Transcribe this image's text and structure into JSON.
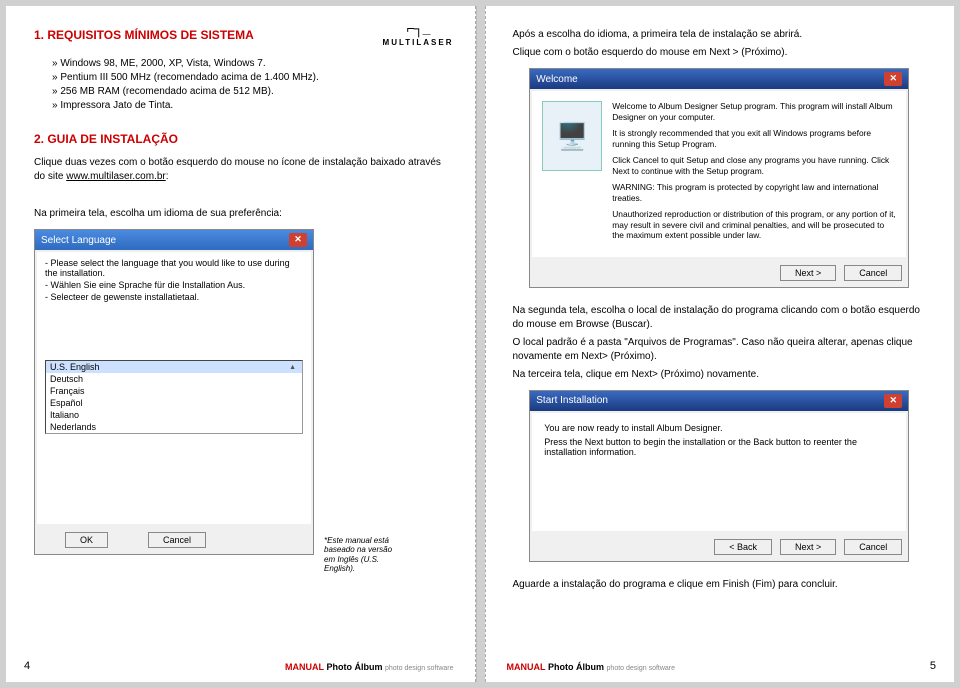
{
  "brand": {
    "glyph": "⌐┐_",
    "name": "MULTILASER"
  },
  "left": {
    "section1_title": "1. REQUISITOS MÍNIMOS DE SISTEMA",
    "requirements": [
      "Windows 98, ME, 2000, XP, Vista, Windows 7.",
      "Pentium III 500 MHz (recomendado acima de 1.400 MHz).",
      "256 MB RAM (recomendado acima de 512 MB).",
      "Impressora Jato de Tinta."
    ],
    "section2_title": "2. GUIA DE INSTALAÇÃO",
    "guide_p1_a": "Clique duas vezes com o botão esquerdo do mouse no ícone de instalação baixado através do site ",
    "guide_p1_link": "www.multilaser.com.br",
    "guide_p1_b": ":",
    "guide_p2": "Na primeira tela, escolha um idioma de sua preferência:",
    "lang_dialog": {
      "title": "Select Language",
      "lines": [
        "- Please select the language that you would like to use during the installation.",
        "- Wählen Sie eine Sprache für die Installation Aus.",
        "- Selecteer de gewenste installatietaal."
      ],
      "options": [
        "U.S. English",
        "Deutsch",
        "Français",
        "Español",
        "Italiano",
        "Nederlands"
      ],
      "ok": "OK",
      "cancel": "Cancel"
    },
    "footnote": "*Este manual está baseado na versão em Inglês (U.S. English).",
    "page_number": "4"
  },
  "right": {
    "intro_p1": "Após a escolha do idioma, a primeira tela de instalação se abrirá.",
    "intro_p2": "Clique com o botão esquerdo do mouse em Next > (Próximo).",
    "welcome_dialog": {
      "title": "Welcome",
      "p1": "Welcome to Album Designer Setup program. This program will install Album Designer on your computer.",
      "p2": "It is strongly recommended that you exit all Windows programs before running this Setup Program.",
      "p3": "Click Cancel to quit Setup and close any programs you have running. Click Next to continue with the Setup program.",
      "p4": "WARNING: This program is protected by copyright law and international treaties.",
      "p5": "Unauthorized reproduction or distribution of this program, or any portion of it, may result in severe civil and criminal penalties, and will be prosecuted to the maximum extent possible under law.",
      "next": "Next >",
      "cancel": "Cancel"
    },
    "mid_p1": "Na segunda tela, escolha o local de instalação do programa clicando com o botão esquerdo do mouse em Browse (Buscar).",
    "mid_p2": "O local padrão é a pasta \"Arquivos de Programas\". Caso não queira alterar, apenas clique novamente em Next> (Próximo).",
    "mid_p3": "Na terceira tela, clique em Next> (Próximo) novamente.",
    "start_dialog": {
      "title": "Start Installation",
      "p1": "You are now ready to install Album Designer.",
      "p2": "Press the Next button to begin the installation or the Back button to reenter the installation information.",
      "back": "< Back",
      "next": "Next >",
      "cancel": "Cancel"
    },
    "final_p": "Aguarde a instalação do programa e clique em Finish (Fim) para concluir.",
    "page_number": "5"
  },
  "footer": {
    "red": "MANUAL",
    "bold": "Photo Álbum",
    "sub": "photo design software"
  }
}
